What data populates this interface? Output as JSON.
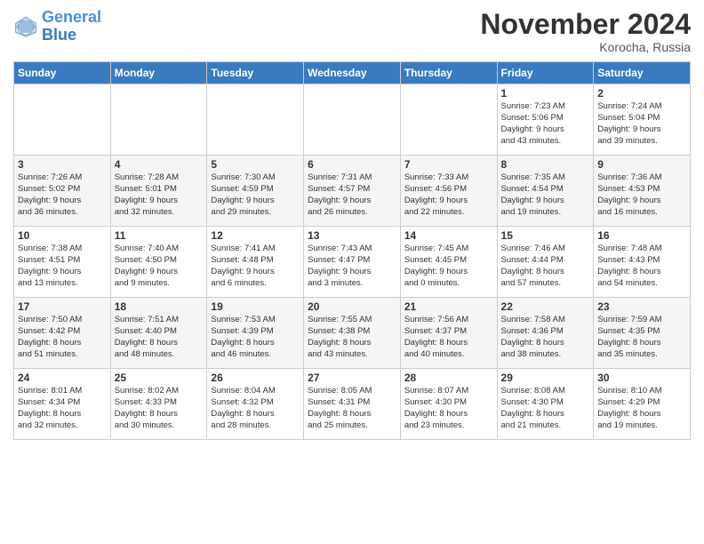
{
  "header": {
    "logo_line1": "General",
    "logo_line2": "Blue",
    "month": "November 2024",
    "location": "Korocha, Russia"
  },
  "weekdays": [
    "Sunday",
    "Monday",
    "Tuesday",
    "Wednesday",
    "Thursday",
    "Friday",
    "Saturday"
  ],
  "rows": [
    [
      {
        "day": "",
        "info": ""
      },
      {
        "day": "",
        "info": ""
      },
      {
        "day": "",
        "info": ""
      },
      {
        "day": "",
        "info": ""
      },
      {
        "day": "",
        "info": ""
      },
      {
        "day": "1",
        "info": "Sunrise: 7:23 AM\nSunset: 5:06 PM\nDaylight: 9 hours\nand 43 minutes."
      },
      {
        "day": "2",
        "info": "Sunrise: 7:24 AM\nSunset: 5:04 PM\nDaylight: 9 hours\nand 39 minutes."
      }
    ],
    [
      {
        "day": "3",
        "info": "Sunrise: 7:26 AM\nSunset: 5:02 PM\nDaylight: 9 hours\nand 36 minutes."
      },
      {
        "day": "4",
        "info": "Sunrise: 7:28 AM\nSunset: 5:01 PM\nDaylight: 9 hours\nand 32 minutes."
      },
      {
        "day": "5",
        "info": "Sunrise: 7:30 AM\nSunset: 4:59 PM\nDaylight: 9 hours\nand 29 minutes."
      },
      {
        "day": "6",
        "info": "Sunrise: 7:31 AM\nSunset: 4:57 PM\nDaylight: 9 hours\nand 26 minutes."
      },
      {
        "day": "7",
        "info": "Sunrise: 7:33 AM\nSunset: 4:56 PM\nDaylight: 9 hours\nand 22 minutes."
      },
      {
        "day": "8",
        "info": "Sunrise: 7:35 AM\nSunset: 4:54 PM\nDaylight: 9 hours\nand 19 minutes."
      },
      {
        "day": "9",
        "info": "Sunrise: 7:36 AM\nSunset: 4:53 PM\nDaylight: 9 hours\nand 16 minutes."
      }
    ],
    [
      {
        "day": "10",
        "info": "Sunrise: 7:38 AM\nSunset: 4:51 PM\nDaylight: 9 hours\nand 13 minutes."
      },
      {
        "day": "11",
        "info": "Sunrise: 7:40 AM\nSunset: 4:50 PM\nDaylight: 9 hours\nand 9 minutes."
      },
      {
        "day": "12",
        "info": "Sunrise: 7:41 AM\nSunset: 4:48 PM\nDaylight: 9 hours\nand 6 minutes."
      },
      {
        "day": "13",
        "info": "Sunrise: 7:43 AM\nSunset: 4:47 PM\nDaylight: 9 hours\nand 3 minutes."
      },
      {
        "day": "14",
        "info": "Sunrise: 7:45 AM\nSunset: 4:45 PM\nDaylight: 9 hours\nand 0 minutes."
      },
      {
        "day": "15",
        "info": "Sunrise: 7:46 AM\nSunset: 4:44 PM\nDaylight: 8 hours\nand 57 minutes."
      },
      {
        "day": "16",
        "info": "Sunrise: 7:48 AM\nSunset: 4:43 PM\nDaylight: 8 hours\nand 54 minutes."
      }
    ],
    [
      {
        "day": "17",
        "info": "Sunrise: 7:50 AM\nSunset: 4:42 PM\nDaylight: 8 hours\nand 51 minutes."
      },
      {
        "day": "18",
        "info": "Sunrise: 7:51 AM\nSunset: 4:40 PM\nDaylight: 8 hours\nand 48 minutes."
      },
      {
        "day": "19",
        "info": "Sunrise: 7:53 AM\nSunset: 4:39 PM\nDaylight: 8 hours\nand 46 minutes."
      },
      {
        "day": "20",
        "info": "Sunrise: 7:55 AM\nSunset: 4:38 PM\nDaylight: 8 hours\nand 43 minutes."
      },
      {
        "day": "21",
        "info": "Sunrise: 7:56 AM\nSunset: 4:37 PM\nDaylight: 8 hours\nand 40 minutes."
      },
      {
        "day": "22",
        "info": "Sunrise: 7:58 AM\nSunset: 4:36 PM\nDaylight: 8 hours\nand 38 minutes."
      },
      {
        "day": "23",
        "info": "Sunrise: 7:59 AM\nSunset: 4:35 PM\nDaylight: 8 hours\nand 35 minutes."
      }
    ],
    [
      {
        "day": "24",
        "info": "Sunrise: 8:01 AM\nSunset: 4:34 PM\nDaylight: 8 hours\nand 32 minutes."
      },
      {
        "day": "25",
        "info": "Sunrise: 8:02 AM\nSunset: 4:33 PM\nDaylight: 8 hours\nand 30 minutes."
      },
      {
        "day": "26",
        "info": "Sunrise: 8:04 AM\nSunset: 4:32 PM\nDaylight: 8 hours\nand 28 minutes."
      },
      {
        "day": "27",
        "info": "Sunrise: 8:05 AM\nSunset: 4:31 PM\nDaylight: 8 hours\nand 25 minutes."
      },
      {
        "day": "28",
        "info": "Sunrise: 8:07 AM\nSunset: 4:30 PM\nDaylight: 8 hours\nand 23 minutes."
      },
      {
        "day": "29",
        "info": "Sunrise: 8:08 AM\nSunset: 4:30 PM\nDaylight: 8 hours\nand 21 minutes."
      },
      {
        "day": "30",
        "info": "Sunrise: 8:10 AM\nSunset: 4:29 PM\nDaylight: 8 hours\nand 19 minutes."
      }
    ]
  ]
}
